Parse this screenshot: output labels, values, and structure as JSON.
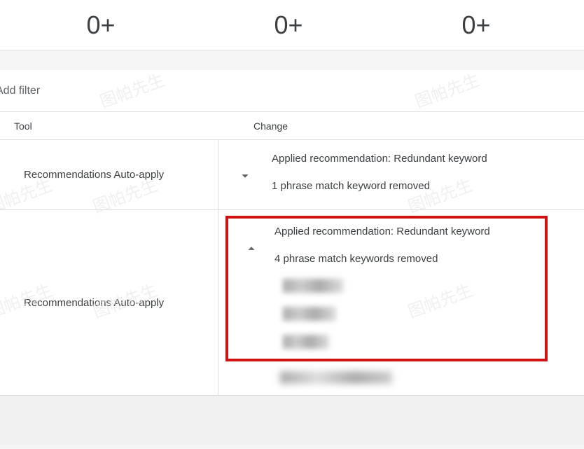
{
  "stats": {
    "s1": "0+",
    "s2": "0+",
    "s3": "0+"
  },
  "filter": {
    "add_label": "Add filter"
  },
  "table": {
    "headers": {
      "tool": "Tool",
      "change": "Change"
    },
    "rows": [
      {
        "tool": "Recommendations Auto-apply",
        "expanded": false,
        "title": "Applied recommendation: Redundant keyword",
        "sub": "1 phrase match keyword removed"
      },
      {
        "tool": "Recommendations Auto-apply",
        "expanded": true,
        "title": "Applied recommendation: Redundant keyword",
        "sub": "4 phrase match keywords removed"
      }
    ]
  },
  "watermark_text": "图帕先生"
}
